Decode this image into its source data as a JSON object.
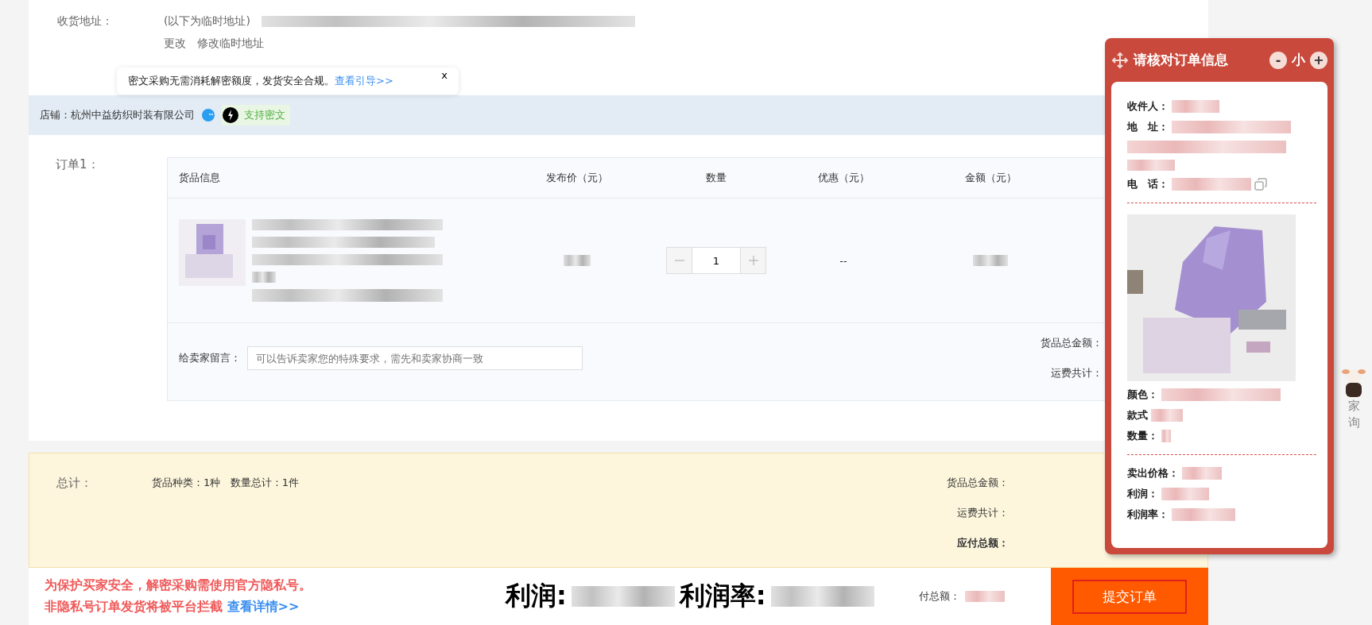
{
  "address": {
    "label": "收货地址：",
    "note": "(以下为临时地址)",
    "actions": [
      "更改",
      "修改临时地址"
    ]
  },
  "tooltip": {
    "text": "密文采购无需消耗解密额度，发货安全合规。",
    "link": "查看引导>>",
    "close": "x"
  },
  "shop": {
    "label": "店铺：杭州中益纺织时装有限公司",
    "badge": "支持密文"
  },
  "order": {
    "label": "订单1：",
    "columns": [
      "货品信息",
      "发布价（元）",
      "数量",
      "优惠（元）",
      "金额（元）"
    ],
    "row": {
      "quantity": "1",
      "discount": "--"
    },
    "message": {
      "label": "给卖家留言：",
      "placeholder": "可以告诉卖家您的特殊要求，需先和卖家协商一致"
    },
    "summary": [
      "货品总金额：",
      "运费共计："
    ]
  },
  "total": {
    "label": "总计：",
    "counts": "货品种类：1种   数量总计：1件",
    "summary": [
      "货品总金额：",
      "运费共计："
    ],
    "payable": "应付总额："
  },
  "bottom": {
    "warning1": "为保护买家安全，解密采购需使用官方隐私号。",
    "warning2": "非隐私号订单发货将被平台拦截",
    "link": "查看详情>>",
    "profit": "利润:",
    "rate": "利润率:",
    "payable": "付总额：",
    "submit": "提交订单"
  },
  "panel": {
    "title": "请核对订单信息",
    "minus": "-",
    "size": "小",
    "plus": "+",
    "contact": [
      "收件人：",
      "地　址：",
      "电　话："
    ],
    "item": [
      "颜色：",
      "款式",
      "数量："
    ],
    "money": [
      "卖出价格：",
      "利润：",
      "利润率："
    ]
  },
  "side_widget": {
    "text": [
      "家",
      "询"
    ]
  }
}
